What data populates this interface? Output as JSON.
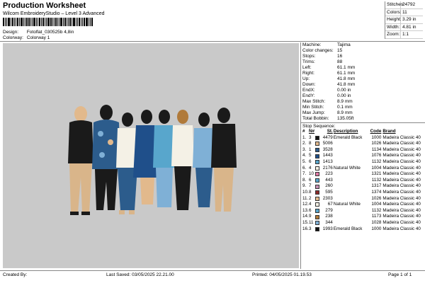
{
  "header": {
    "title": "Production Worksheet",
    "subtitle": "Wilcom EmbroideryStudio – Level 3 Advanced",
    "design_label": "Design:",
    "design_value": "Fotoflat_030525b 4,8in",
    "colorway_label": "Colorway:",
    "colorway_value": "Colorway 1"
  },
  "stats": [
    {
      "k": "Stitches:",
      "v": "24792"
    },
    {
      "k": "Colors:",
      "v": "11"
    },
    {
      "k": "Height:",
      "v": "3.29 in"
    },
    {
      "k": "Width:",
      "v": "4.81 in"
    },
    {
      "k": "Zoom:",
      "v": "1:1"
    }
  ],
  "machine": [
    {
      "k": "Machine:",
      "v": "Tajima"
    },
    {
      "k": "Color changes:",
      "v": "15"
    },
    {
      "k": "Stops:",
      "v": "16"
    },
    {
      "k": "Trims:",
      "v": "88"
    },
    {
      "k": "Left:",
      "v": "61.1 mm"
    },
    {
      "k": "Right:",
      "v": "61.1 mm"
    },
    {
      "k": "Up:",
      "v": "41.8 mm"
    },
    {
      "k": "Down:",
      "v": "41.8 mm"
    },
    {
      "k": "EndX:",
      "v": "0.00 in"
    },
    {
      "k": "EndY:",
      "v": "0.00 in"
    },
    {
      "k": "Max Stitch:",
      "v": "8.9 mm"
    },
    {
      "k": "Min Stitch:",
      "v": "0.1 mm"
    },
    {
      "k": "Max Jump:",
      "v": "8.9 mm"
    },
    {
      "k": "Total Bobbin:",
      "v": "135.05ft"
    }
  ],
  "sequence": {
    "title": "Stop Sequence:",
    "headers": {
      "n": "#",
      "np": "N#",
      "st": "St.",
      "desc": "Description",
      "code": "Code",
      "brand": "Brand"
    },
    "rows": [
      {
        "n": "1.",
        "np": "3",
        "color": "#111111",
        "st": "4479",
        "desc": "Emerald Black",
        "code": "1000",
        "brand": "Madeira Classic 40"
      },
      {
        "n": "2.",
        "np": "8",
        "color": "#e2b98c",
        "st": "5006",
        "desc": "",
        "code": "1026",
        "brand": "Madeira Classic 40"
      },
      {
        "n": "3.",
        "np": "1",
        "color": "#2c5c8c",
        "st": "3528",
        "desc": "",
        "code": "1134",
        "brand": "Madeira Classic 40"
      },
      {
        "n": "4.",
        "np": "5",
        "color": "#1f4f8a",
        "st": "1443",
        "desc": "",
        "code": "1076",
        "brand": "Madeira Classic 40"
      },
      {
        "n": "5.",
        "np": "6",
        "color": "#58a6cc",
        "st": "1413",
        "desc": "",
        "code": "1132",
        "brand": "Madeira Classic 40"
      },
      {
        "n": "6.",
        "np": "4",
        "color": "#f4f1e6",
        "st": "2176",
        "desc": "Natural White",
        "code": "1004",
        "brand": "Madeira Classic 40"
      },
      {
        "n": "7.",
        "np": "10",
        "color": "#e07aa6",
        "st": "223",
        "desc": "",
        "code": "1321",
        "brand": "Madeira Classic 40"
      },
      {
        "n": "8.",
        "np": "6",
        "color": "#58a6cc",
        "st": "443",
        "desc": "",
        "code": "1132",
        "brand": "Madeira Classic 40"
      },
      {
        "n": "9.",
        "np": "7",
        "color": "#c68fb2",
        "st": "260",
        "desc": "",
        "code": "1317",
        "brand": "Madeira Classic 40"
      },
      {
        "n": "10.",
        "np": "8",
        "color": "#8c2a2a",
        "st": "595",
        "desc": "",
        "code": "1374",
        "brand": "Madeira Classic 40"
      },
      {
        "n": "11.",
        "np": "2",
        "color": "#e2b98c",
        "st": "2303",
        "desc": "",
        "code": "1026",
        "brand": "Madeira Classic 40"
      },
      {
        "n": "12.",
        "np": "4",
        "color": "#f4f1e6",
        "st": "67",
        "desc": "Natural White",
        "code": "1004",
        "brand": "Madeira Classic 40"
      },
      {
        "n": "13.",
        "np": "6",
        "color": "#58a6cc",
        "st": "279",
        "desc": "",
        "code": "1132",
        "brand": "Madeira Classic 40"
      },
      {
        "n": "14.",
        "np": "9",
        "color": "#b07a3a",
        "st": "238",
        "desc": "",
        "code": "1173",
        "brand": "Madeira Classic 40"
      },
      {
        "n": "15.",
        "np": "11",
        "color": "#7fb0d6",
        "st": "344",
        "desc": "",
        "code": "1028",
        "brand": "Madeira Classic 40"
      },
      {
        "n": "16.",
        "np": "3",
        "color": "#111111",
        "st": "1993",
        "desc": "Emerald Black",
        "code": "1000",
        "brand": "Madeira Classic 40"
      }
    ]
  },
  "footer": {
    "created": "Created By:",
    "saved": "Last Saved: 03/05/2025 22.21.00",
    "printed": "Printed: 04/05/2025 01.19.53",
    "page": "Page 1 of 1"
  }
}
